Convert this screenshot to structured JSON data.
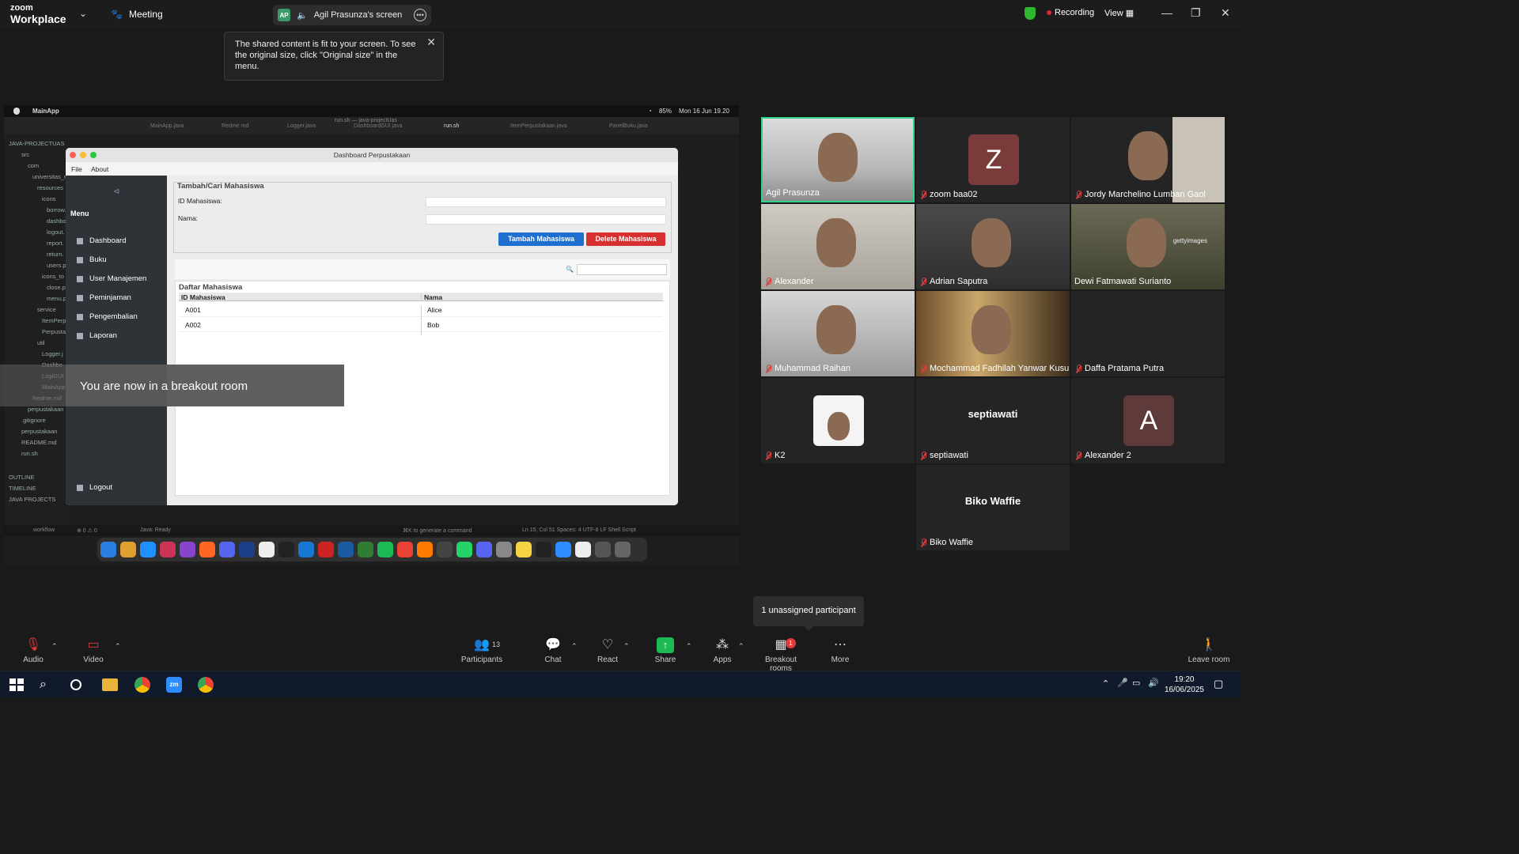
{
  "zoom": {
    "logo_line1": "zoom",
    "logo_line2": "Workplace",
    "meeting_label": "Meeting",
    "share_initials": "AP",
    "share_title": "Agil Prasunza's screen",
    "recording_label": "Recording",
    "view_label": "View",
    "toast_text": "The shared content is fit to your screen. To see the original size, click \"Original size\" in the menu."
  },
  "mac": {
    "app_name": "MainApp",
    "battery": "85%",
    "datetime": "Mon 16 Jun 19.20",
    "vscode_title": "run.sh — java-projectUas",
    "tabs": [
      "MainApp.java",
      "Redme.md",
      "Logger.java",
      "DashboardGUI.java",
      "run.sh",
      "ItemPerpustakaan.java",
      "PanelBuku.java"
    ],
    "sidebar": [
      "JAVA-PROJECTUAS",
      "src",
      "com",
      "universitas_r",
      "resources",
      "icons",
      "borrow.",
      "dashbo",
      "logout.",
      "report.",
      "return.",
      "users.p",
      "icons_to",
      "close.p",
      "menu.p",
      "service",
      "ItemPerp",
      "Perpusta",
      "util",
      "Logger.j",
      "Dashbo",
      "LogiGUI",
      "MainApp.j",
      "Redme.md",
      "perpustakaan",
      ".gitignore",
      "perpustakaan",
      "README.md",
      "run.sh",
      "OUTLINE",
      "TIMELINE",
      "JAVA PROJECTS"
    ],
    "status_left": "workflow",
    "status_counts": "⊗ 0 ⚠ 0",
    "status_java": "Java: Ready",
    "status_cmd": "⌘K to generate a command",
    "status_right": "Ln 15, Col 51   Spaces: 4   UTF-8   LF   Shell Script"
  },
  "java_app": {
    "window_title": "Dashboard Perpustakaan",
    "menu_file": "File",
    "menu_about": "About",
    "sidebar_heading": "Menu",
    "nav": [
      "Dashboard",
      "Buku",
      "User Manajemen",
      "Peminjaman",
      "Pengembalian",
      "Laporan"
    ],
    "logout": "Logout",
    "form_title": "Tambah/Cari Mahasiswa",
    "label_id": "ID Mahasiswa:",
    "label_nama": "Nama:",
    "input_id_value": "",
    "input_nama_value": "",
    "btn_add": "Tambah Mahasiswa",
    "btn_delete": "Delete Mahasiswa",
    "search_value": "",
    "table_title": "Daftar Mahasiswa",
    "columns": [
      "ID Mahasiswa",
      "Nama"
    ],
    "rows": [
      [
        "A001",
        "Alice"
      ],
      [
        "A002",
        "Bob"
      ]
    ]
  },
  "breakout_banner": "You are now in a breakout room",
  "participants": [
    {
      "name": "Agil Prasunza",
      "muted": false,
      "type": "video",
      "active": true
    },
    {
      "name": "zoom baa02",
      "muted": true,
      "type": "avatar",
      "initial": "Z",
      "color": "#7a3b3b"
    },
    {
      "name": "Jordy Marchelino Lumban Gaol",
      "muted": true,
      "type": "video"
    },
    {
      "name": "Alexander",
      "muted": true,
      "type": "video"
    },
    {
      "name": "Adrian Saputra",
      "muted": true,
      "type": "video"
    },
    {
      "name": "Dewi Fatmawati Surianto",
      "muted": false,
      "type": "video",
      "watermark": "gettyimages"
    },
    {
      "name": "Muhammad Raihan",
      "muted": true,
      "type": "video"
    },
    {
      "name": "Mochammad Fadhilah Yanwar Kusu...",
      "muted": true,
      "type": "video"
    },
    {
      "name": "Daffa Pratama Putra",
      "muted": true,
      "type": "blank"
    },
    {
      "name": "K2",
      "muted": true,
      "type": "photo"
    },
    {
      "name": "septiawati",
      "muted": true,
      "type": "name",
      "display": "septiawati"
    },
    {
      "name": "Alexander 2",
      "muted": true,
      "type": "avatar",
      "initial": "A",
      "color": "#5e3a3a"
    },
    {
      "name": "Biko Waffie",
      "muted": true,
      "type": "name",
      "display": "Biko Waffie"
    }
  ],
  "unassigned_tooltip": "1 unassigned participant",
  "toolbar": {
    "audio": "Audio",
    "video": "Video",
    "participants": "Participants",
    "participants_count": "13",
    "chat": "Chat",
    "react": "React",
    "share": "Share",
    "apps": "Apps",
    "breakout": "Breakout rooms",
    "breakout_badge": "1",
    "more": "More",
    "leave": "Leave room"
  },
  "taskbar": {
    "time": "19:20",
    "date": "16/06/2025"
  },
  "colors": {
    "active_tile_border": "#2fd38a",
    "btn_add": "#1f6fd1",
    "btn_delete": "#d63030",
    "share_green": "#1db954",
    "mute_red": "#e03a3a"
  }
}
